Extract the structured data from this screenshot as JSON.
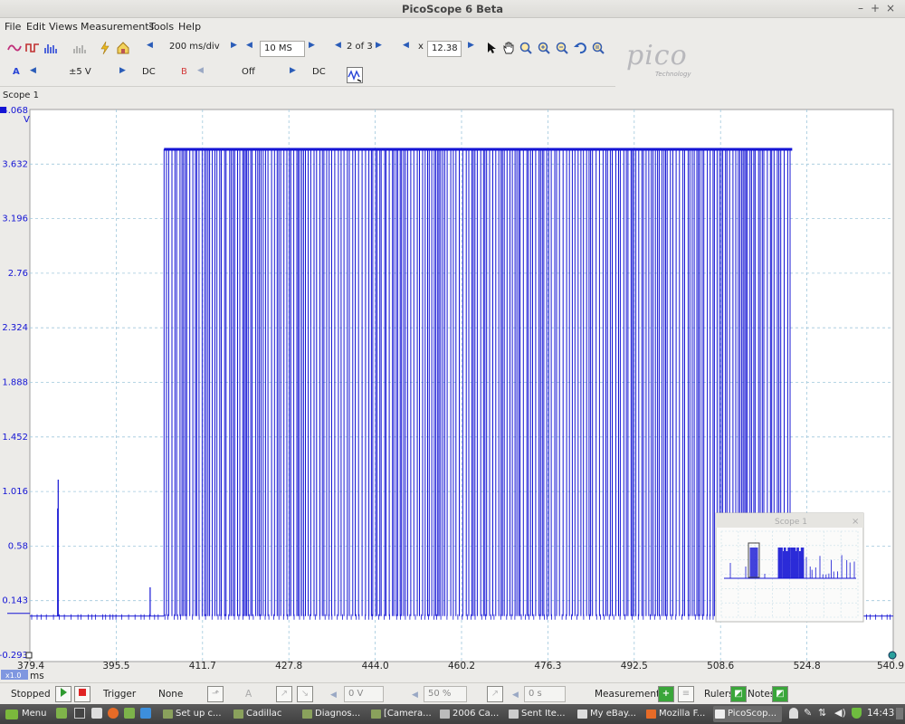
{
  "window": {
    "title": "PicoScope 6 Beta",
    "minimize": "–",
    "maximize": "+",
    "close": "×"
  },
  "menu": [
    "File",
    "Edit",
    "Views",
    "Measurements",
    "Tools",
    "Help"
  ],
  "toolbar": {
    "timebase": "200 ms/div",
    "samples": "10 MS",
    "buffer": "2 of 3",
    "zoom_x_label": "x",
    "zoom_value": "12.38"
  },
  "channel_a": {
    "label": "A",
    "range": "±5 V",
    "coupling": "DC",
    "color": "#2a46d6"
  },
  "channel_b": {
    "label": "B",
    "range": "Off",
    "coupling": "DC",
    "color": "#d43a3a"
  },
  "logo": {
    "word": "pico",
    "sub": "Technology"
  },
  "scope_tab": "Scope 1",
  "chart_data": {
    "type": "line",
    "y_unit": "V",
    "x_unit": "ms",
    "x_zoom_badge": "x1.0",
    "yticks": [
      "4.068",
      "3.632",
      "3.196",
      "2.76",
      "2.324",
      "1.888",
      "1.452",
      "1.016",
      "0.58",
      "0.143",
      "-0.293"
    ],
    "xticks": [
      "379.4",
      "395.5",
      "411.7",
      "427.8",
      "444.0",
      "460.2",
      "476.3",
      "492.5",
      "508.6",
      "524.8",
      "540.9"
    ],
    "xlim": [
      379.4,
      540.9
    ],
    "ylim": [
      -0.293,
      4.068
    ],
    "series_color": "#1414d4",
    "baseline_v": 0.02,
    "high_v": 3.75,
    "burst_start_ms": 404.5,
    "burst_end_ms": 522.0,
    "spikes": [
      {
        "x": 384.7,
        "v": 1.11
      },
      {
        "x": 384.6,
        "v": 0.88
      },
      {
        "x": 401.9,
        "v": 0.25
      }
    ],
    "grid": true
  },
  "overview": {
    "title": "Scope 1",
    "close": "×"
  },
  "status": {
    "state": "Stopped",
    "trigger_label": "Trigger",
    "trigger_mode": "None",
    "channel": "A",
    "threshold": "0 V",
    "pretrigger": "50 %",
    "delay": "0 s",
    "measurements": "Measurements",
    "rulers": "Rulers",
    "notes": "Notes"
  },
  "taskbar": {
    "menu": "Menu",
    "tasks": [
      "Set up c...",
      "Cadillac",
      "Diagnos...",
      "[Camera...",
      "2006 Ca...",
      "Sent Ite...",
      "My eBay...",
      "Mozilla F...",
      "PicoScop..."
    ],
    "clock": "14:43"
  }
}
